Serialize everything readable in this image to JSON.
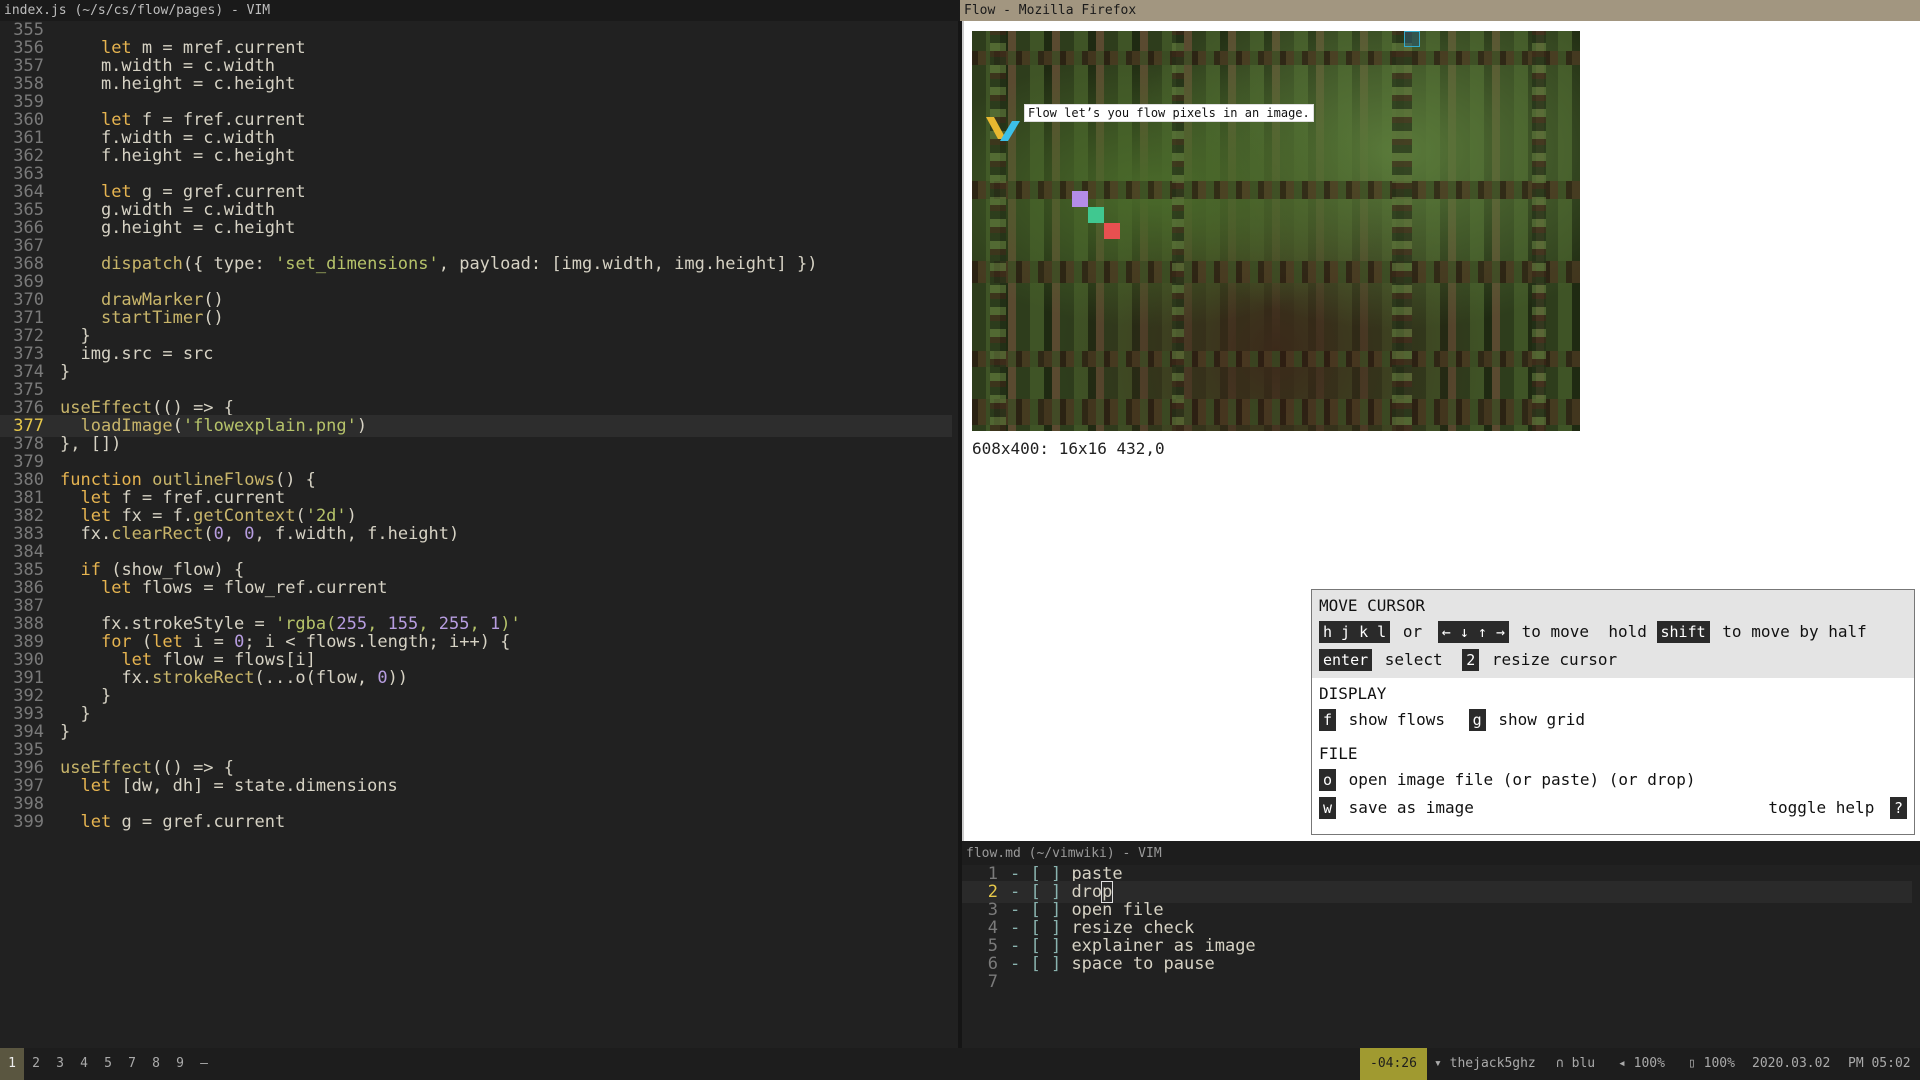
{
  "left_vim": {
    "title": "index.js (~/s/cs/flow/pages) - VIM",
    "current_line": "377",
    "lines": [
      {
        "n": "355",
        "t": ""
      },
      {
        "n": "356",
        "t": "    let m = mref.current"
      },
      {
        "n": "357",
        "t": "    m.width = c.width"
      },
      {
        "n": "358",
        "t": "    m.height = c.height"
      },
      {
        "n": "359",
        "t": ""
      },
      {
        "n": "360",
        "t": "    let f = fref.current"
      },
      {
        "n": "361",
        "t": "    f.width = c.width"
      },
      {
        "n": "362",
        "t": "    f.height = c.height"
      },
      {
        "n": "363",
        "t": ""
      },
      {
        "n": "364",
        "t": "    let g = gref.current"
      },
      {
        "n": "365",
        "t": "    g.width = c.width"
      },
      {
        "n": "366",
        "t": "    g.height = c.height"
      },
      {
        "n": "367",
        "t": ""
      },
      {
        "n": "368",
        "t": "    dispatch({ type: 'set_dimensions', payload: [img.width, img.height] })"
      },
      {
        "n": "369",
        "t": ""
      },
      {
        "n": "370",
        "t": "    drawMarker()"
      },
      {
        "n": "371",
        "t": "    startTimer()"
      },
      {
        "n": "372",
        "t": "  }"
      },
      {
        "n": "373",
        "t": "  img.src = src"
      },
      {
        "n": "374",
        "t": "}"
      },
      {
        "n": "375",
        "t": ""
      },
      {
        "n": "376",
        "t": "useEffect(() => {"
      },
      {
        "n": "377",
        "t": "  loadImage('flowexplain.png')"
      },
      {
        "n": "378",
        "t": "}, [])"
      },
      {
        "n": "379",
        "t": ""
      },
      {
        "n": "380",
        "t": "function outlineFlows() {"
      },
      {
        "n": "381",
        "t": "  let f = fref.current"
      },
      {
        "n": "382",
        "t": "  let fx = f.getContext('2d')"
      },
      {
        "n": "383",
        "t": "  fx.clearRect(0, 0, f.width, f.height)"
      },
      {
        "n": "384",
        "t": ""
      },
      {
        "n": "385",
        "t": "  if (show_flow) {"
      },
      {
        "n": "386",
        "t": "    let flows = flow_ref.current"
      },
      {
        "n": "387",
        "t": ""
      },
      {
        "n": "388",
        "t": "    fx.strokeStyle = 'rgba(255, 155, 255, 1)'"
      },
      {
        "n": "389",
        "t": "    for (let i = 0; i < flows.length; i++) {"
      },
      {
        "n": "390",
        "t": "      let flow = flows[i]"
      },
      {
        "n": "391",
        "t": "      fx.strokeRect(...o(flow, 0))"
      },
      {
        "n": "392",
        "t": "    }"
      },
      {
        "n": "393",
        "t": "  }"
      },
      {
        "n": "394",
        "t": "}"
      },
      {
        "n": "395",
        "t": ""
      },
      {
        "n": "396",
        "t": "useEffect(() => {"
      },
      {
        "n": "397",
        "t": "  let [dw, dh] = state.dimensions"
      },
      {
        "n": "398",
        "t": ""
      },
      {
        "n": "399",
        "t": "  let g = gref.current"
      }
    ]
  },
  "firefox": {
    "title": "Flow - Mozilla Firefox",
    "canvas_caption": "Flow let’s you flow pixels in an image.",
    "status_text": "608x400: 16x16 432,0",
    "help": {
      "move_cursor": {
        "heading": "MOVE CURSOR",
        "key_hjkl": "h j k l",
        "or": "or",
        "key_arrows": "← ↓ ↑ →",
        "to_move": "to move  hold",
        "key_shift": "shift",
        "to_move_half": "to move by half",
        "key_enter": "enter",
        "select": "select",
        "key_2": "2",
        "resize_cursor": "resize cursor"
      },
      "display": {
        "heading": "DISPLAY",
        "key_f": "f",
        "show_flows": "show flows",
        "key_g": "g",
        "show_grid": "show grid"
      },
      "file": {
        "heading": "FILE",
        "key_o": "o",
        "open": "open image file (or paste) (or drop)",
        "key_w": "w",
        "save": "save as image",
        "toggle_help": "toggle help",
        "key_q": "?"
      }
    },
    "colors": {
      "marker_yellow": "#e8b830",
      "marker_cyan": "#3cc0e8",
      "marker_purple": "#b48ce8",
      "marker_green": "#40c890",
      "marker_red": "#e85050"
    }
  },
  "right_vim": {
    "title": "flow.md (~/vimwiki) - VIM",
    "current_line": "2",
    "items": [
      {
        "n": "1",
        "box": "- [ ]",
        "t": "paste"
      },
      {
        "n": "2",
        "box": "- [ ]",
        "t": "drop"
      },
      {
        "n": "3",
        "box": "- [ ]",
        "t": "open file"
      },
      {
        "n": "4",
        "box": "- [ ]",
        "t": "resize check"
      },
      {
        "n": "5",
        "box": "- [ ]",
        "t": "explainer as image"
      },
      {
        "n": "6",
        "box": "- [ ]",
        "t": "space to pause"
      },
      {
        "n": "7",
        "box": "",
        "t": ""
      }
    ]
  },
  "statusbar": {
    "workspaces": [
      "1",
      "2",
      "3",
      "4",
      "5",
      "7",
      "8",
      "9",
      "–"
    ],
    "active_workspace": "1",
    "timer": "-04:26",
    "wifi": "thejack5ghz",
    "audio_device": "blu",
    "volume": "100%",
    "battery": "100%",
    "date": "2020.03.02",
    "time": "PM 05:02"
  }
}
